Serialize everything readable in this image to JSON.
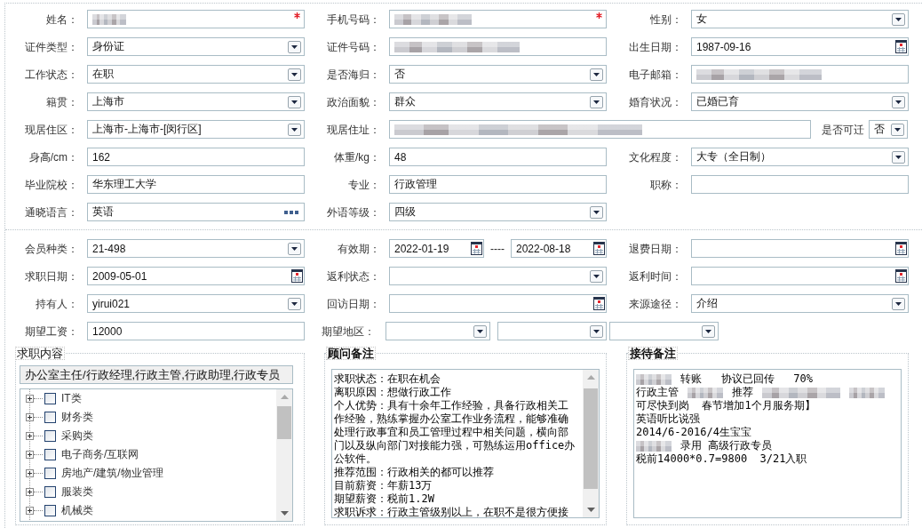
{
  "personal_info": {
    "rows": [
      [
        {
          "label": "姓名：",
          "kind": "text",
          "redacted": {
            "kind": "short"
          },
          "required": true
        },
        {
          "label": "手机号码：",
          "kind": "text",
          "redacted": {
            "kind": "medium"
          },
          "required": true
        },
        {
          "label": "性别：",
          "kind": "select",
          "value": "女",
          "required": false
        }
      ],
      [
        {
          "label": "证件类型：",
          "kind": "select",
          "value": "身份证",
          "required": false
        },
        {
          "label": "证件号码：",
          "kind": "text",
          "redacted": {
            "kind": "long"
          },
          "required": false
        },
        {
          "label": "出生日期：",
          "kind": "date",
          "value": "1987-09-16",
          "required": false
        }
      ],
      [
        {
          "label": "工作状态：",
          "kind": "select",
          "value": "在职",
          "required": false
        },
        {
          "label": "是否海归：",
          "kind": "select",
          "value": "否",
          "required": false
        },
        {
          "label": "电子邮箱：",
          "kind": "text",
          "redacted": {
            "kind": "long"
          },
          "required": false
        }
      ],
      [
        {
          "label": "籍贯：",
          "kind": "select",
          "value": "上海市",
          "required": false
        },
        {
          "label": "政治面貌：",
          "kind": "select",
          "value": "群众",
          "required": false
        },
        {
          "label": "婚育状况：",
          "kind": "select",
          "value": "已婚已育",
          "required": false
        }
      ],
      [
        {
          "label": "现居住区：",
          "kind": "select",
          "value": "上海市-上海市-[闵行区]",
          "required": false
        },
        {
          "label": "现居住址：",
          "kind": "wide_text",
          "redacted": {
            "kind": "long"
          },
          "required": false
        },
        {
          "label": "是否可迁",
          "kind": "small_select",
          "value": "否",
          "required": false
        }
      ],
      [
        {
          "label": "身高/cm：",
          "kind": "text",
          "value": "162",
          "required": false
        },
        {
          "label": "体重/kg：",
          "kind": "text",
          "value": "48",
          "required": false
        },
        {
          "label": "文化程度：",
          "kind": "select",
          "value": "大专（全日制）",
          "required": false
        }
      ],
      [
        {
          "label": "毕业院校：",
          "kind": "text",
          "value": "华东理工大学",
          "required": false
        },
        {
          "label": "专业：",
          "kind": "text",
          "value": "行政管理",
          "required": false
        },
        {
          "label": "职称：",
          "kind": "text",
          "required": false
        }
      ],
      [
        {
          "label": "通晓语言：",
          "kind": "picker",
          "value": "英语",
          "required": false
        },
        {
          "label": "外语等级：",
          "kind": "select",
          "value": "四级",
          "required": false
        }
      ]
    ]
  },
  "membership": {
    "rows": [
      [
        {
          "label": "会员种类：",
          "kind": "select",
          "value": "21-498"
        },
        {
          "label": "有效期：",
          "kind": "date_range",
          "from": "2022-01-19",
          "separator": "----",
          "to": "2022-08-18"
        },
        {
          "label": "退费日期：",
          "kind": "date"
        }
      ],
      [
        {
          "label": "求职日期：",
          "kind": "date",
          "value": "2009-05-01"
        },
        {
          "label": "返利状态：",
          "kind": "select"
        },
        {
          "label": "返利时间：",
          "kind": "date"
        }
      ],
      [
        {
          "label": "持有人：",
          "kind": "select",
          "value": "yirui021"
        },
        {
          "label": "回访日期：",
          "kind": "date"
        },
        {
          "label": "来源途径：",
          "kind": "select",
          "value": "介绍"
        }
      ],
      [
        {
          "label": "期望工资：",
          "kind": "text",
          "value": "12000"
        },
        {
          "label": "期望地区：",
          "kind": "select_group",
          "selects": [
            {
              "kind": "select"
            },
            {
              "kind": "select"
            },
            {
              "kind": "select"
            }
          ]
        }
      ]
    ]
  },
  "job_intent": {
    "legend": "求职内容",
    "selection": "办公室主任/行政经理,行政主管,行政助理,行政专员",
    "categories": [
      {
        "label": "IT类",
        "expanded": false,
        "checked": false
      },
      {
        "label": "财务类",
        "expanded": false,
        "checked": false
      },
      {
        "label": "采购类",
        "expanded": false,
        "checked": false
      },
      {
        "label": "电子商务/互联网",
        "expanded": false,
        "checked": false
      },
      {
        "label": "房地产/建筑/物业管理",
        "expanded": false,
        "checked": false
      },
      {
        "label": "服装类",
        "expanded": false,
        "checked": false
      },
      {
        "label": "机械类",
        "expanded": false,
        "checked": false
      }
    ]
  },
  "consultant_notes": {
    "legend": "顾问备注",
    "paragraphs": [
      "求职状态：在职在机会",
      "离职原因：想做行政工作",
      "个人优势：具有十余年工作经验，具备行政相关工作经验，熟练掌握办公室工作业务流程，能够准确处理行政事宜和员工管理过程中相关问题，横向部门以及纵向部门对接能力强，可熟练运用office办公软件。",
      "推荐范围：行政相关的都可以推荐",
      "目前薪资：年薪13万",
      "期望薪资：税前1.2W",
      "求职诉求：行政主管级别以上，在职不是很方便接"
    ]
  },
  "reception_notes": {
    "legend": "接待备注",
    "lines": [
      {
        "parts": [
          {
            "kind": "redacted_short"
          },
          {
            "kind": "text",
            "text": "转账   协议已回传   70%"
          }
        ]
      },
      {
        "parts": [
          {
            "kind": "text",
            "text": "行政主管"
          },
          {
            "kind": "redacted_short"
          },
          {
            "kind": "text",
            "text": "推荐"
          },
          {
            "kind": "redacted_medium"
          },
          {
            "kind": "redacted_short"
          }
        ]
      },
      {
        "parts": [
          {
            "kind": "text",
            "text": "可尽快到岗  春节增加1个月服务期】"
          }
        ]
      },
      {
        "parts": [
          {
            "kind": "text",
            "text": "英语听比说强"
          }
        ]
      },
      {
        "parts": [
          {
            "kind": "text",
            "text": "2014/6-2016/4生宝宝"
          }
        ]
      },
      {
        "parts": [
          {
            "kind": "redacted_short"
          },
          {
            "kind": "text",
            "text": "录用 高级行政专员"
          }
        ]
      },
      {
        "parts": [
          {
            "kind": "text",
            "text": "税前14000*0.7=9800  3/21入职"
          }
        ]
      }
    ]
  }
}
